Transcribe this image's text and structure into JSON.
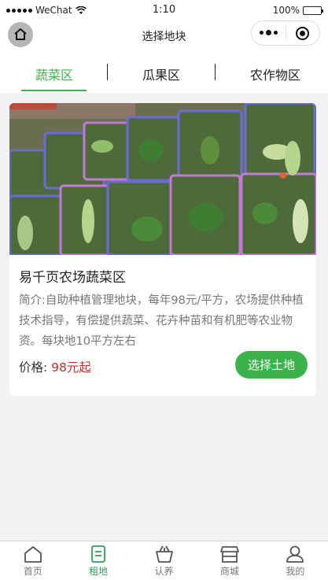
{
  "status_bar": {
    "carrier": "WeChat",
    "time": "1:10",
    "battery_percent": "100%",
    "battery_level": 1.0
  },
  "nav": {
    "title": "选择地块"
  },
  "category_tabs": [
    {
      "label": "蔬菜区",
      "active": true
    },
    {
      "label": "瓜果区",
      "active": false
    },
    {
      "label": "农作物区",
      "active": false
    }
  ],
  "card": {
    "title": "易千页农场蔬菜区",
    "description": "简介:自助种植管理地块，每年98元/平方，农场提供种植技术指导，有偿提供蔬菜、花卉种苗和有机肥等农业物资。每块地10平方左右",
    "price_label": "价格: ",
    "price_value": "98元起",
    "button_label": "选择土地",
    "image_icon": "vegetable-baskets-photo"
  },
  "tabbar": {
    "items": [
      {
        "label": "首页",
        "icon": "home-icon",
        "active": false
      },
      {
        "label": "租地",
        "icon": "document-icon",
        "active": true
      },
      {
        "label": "认养",
        "icon": "basket-icon",
        "active": false
      },
      {
        "label": "商城",
        "icon": "store-icon",
        "active": false
      },
      {
        "label": "我的",
        "icon": "user-icon",
        "active": false
      }
    ]
  },
  "colors": {
    "accent": "#3bb34a",
    "price": "#c0302b",
    "tab_active": "#2e9f5c"
  }
}
